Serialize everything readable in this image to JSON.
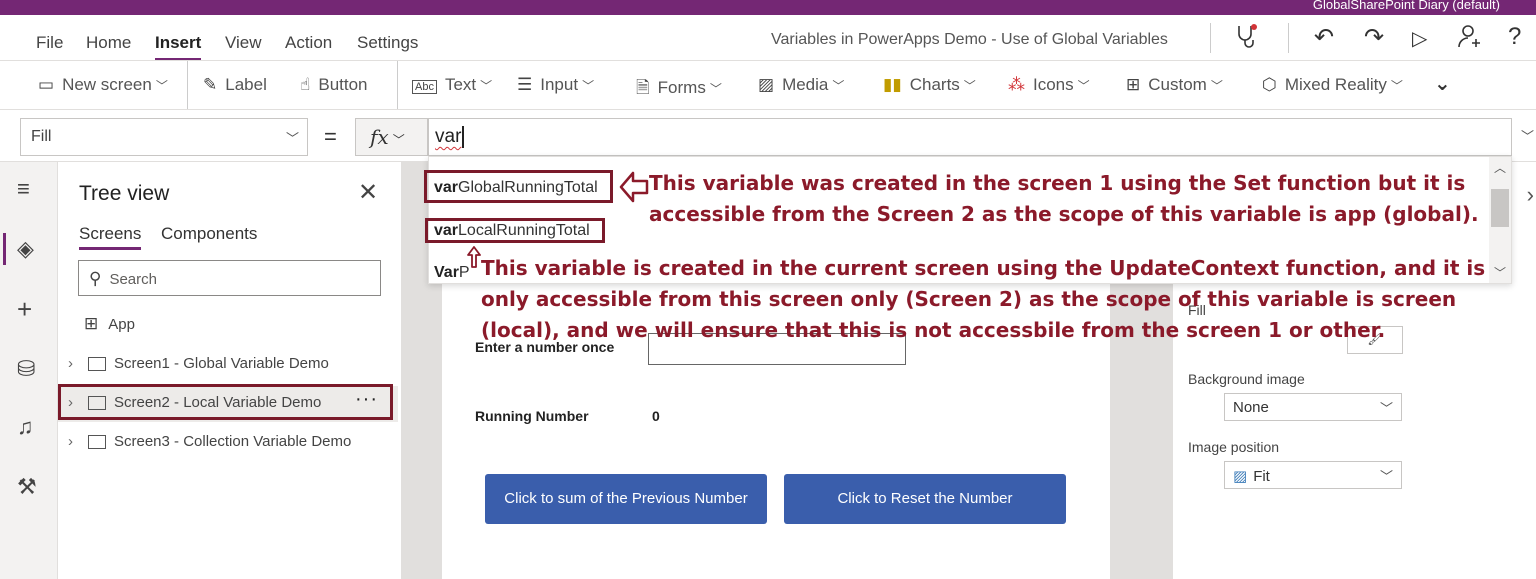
{
  "topbar": {
    "title": "GlobalSharePoint Diary (default)"
  },
  "menu": {
    "items": [
      "File",
      "Home",
      "Insert",
      "View",
      "Action",
      "Settings"
    ],
    "active": "Insert",
    "doc_title": "Variables in PowerApps Demo - Use of Global Variables"
  },
  "toolbar_icons": [
    "stethoscope-icon",
    "undo-icon",
    "redo-icon",
    "play-icon",
    "share-user-icon",
    "help-icon"
  ],
  "ribbon": {
    "new_screen": "New screen",
    "label": "Label",
    "button": "Button",
    "text": "Text",
    "input": "Input",
    "forms": "Forms",
    "media": "Media",
    "charts": "Charts",
    "icons": "Icons",
    "custom": "Custom",
    "mixed_reality": "Mixed Reality"
  },
  "formula": {
    "property": "Fill",
    "equals": "=",
    "fx": "fx",
    "value": "var"
  },
  "intellisense": {
    "items": [
      {
        "prefix": "var",
        "rest": "GlobalRunningTotal"
      },
      {
        "prefix": "var",
        "rest": "LocalRunningTotal"
      },
      {
        "prefix": "Var",
        "rest": "P"
      }
    ]
  },
  "annotations": {
    "global_line1": "This variable was created in the screen 1 using the Set function but it is",
    "global_line2": "accessible from the Screen 2 as the scope of this variable is app (global).",
    "local_line1": "This variable is created in the current screen using the UpdateContext function, and it is",
    "local_line2": "only accessible from this screen only (Screen 2) as the scope of this variable is screen",
    "local_line3": "(local), and we will ensure that this is not accessbile from the screen 1 or other."
  },
  "treeview": {
    "title": "Tree view",
    "tabs": [
      "Screens",
      "Components"
    ],
    "search_placeholder": "Search",
    "app_label": "App",
    "screens": [
      "Screen1 - Global Variable Demo",
      "Screen2 - Local Variable Demo",
      "Screen3 - Collection Variable Demo"
    ],
    "selected_index": 1
  },
  "canvas": {
    "label_enter": "Enter a number once",
    "label_running": "Running Number",
    "running_value": "0",
    "button_sum": "Click to sum of the Previous Number",
    "button_reset": "Click to Reset the Number"
  },
  "properties": {
    "fill_label": "Fill",
    "background_image_label": "Background image",
    "background_image_value": "None",
    "image_position_label": "Image position",
    "image_position_value": "Fit"
  },
  "colors": {
    "brand_purple": "#742774",
    "annotation_red": "#8b1a2a",
    "button_blue": "#3a5eac"
  }
}
